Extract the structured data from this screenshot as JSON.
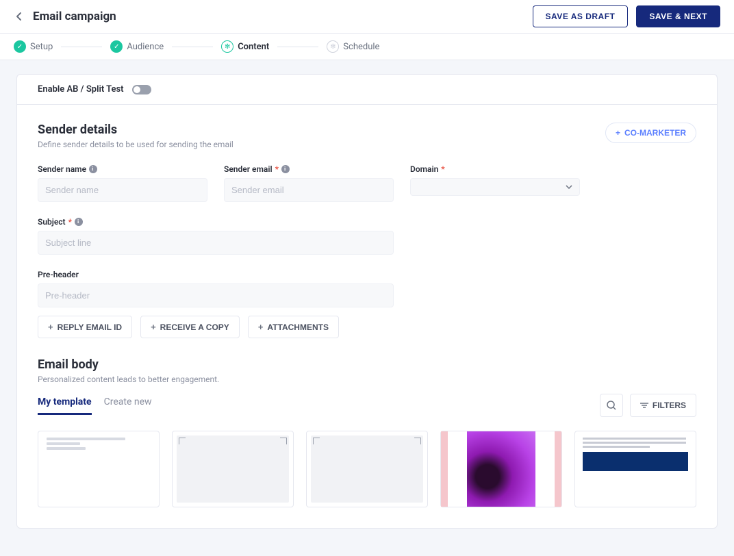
{
  "header": {
    "title": "Email campaign",
    "save_draft": "SAVE AS DRAFT",
    "save_next": "SAVE & NEXT"
  },
  "steps": {
    "setup": "Setup",
    "audience": "Audience",
    "content": "Content",
    "schedule": "Schedule"
  },
  "ab_test": {
    "label": "Enable AB / Split Test"
  },
  "sender": {
    "title": "Sender details",
    "subtitle": "Define sender details to be used for sending the email",
    "co_marketer": "CO-MARKETER",
    "name_label": "Sender name",
    "name_placeholder": "Sender name",
    "email_label": "Sender email",
    "email_placeholder": "Sender email",
    "domain_label": "Domain",
    "subject_label": "Subject",
    "subject_placeholder": "Subject line",
    "preheader_label": "Pre-header",
    "preheader_placeholder": "Pre-header"
  },
  "chips": {
    "reply": "REPLY EMAIL ID",
    "copy": "RECEIVE A COPY",
    "attach": "ATTACHMENTS"
  },
  "body": {
    "title": "Email body",
    "subtitle": "Personalized content leads to better engagement.",
    "tab_my": "My template",
    "tab_new": "Create new",
    "filters": "FILTERS"
  }
}
